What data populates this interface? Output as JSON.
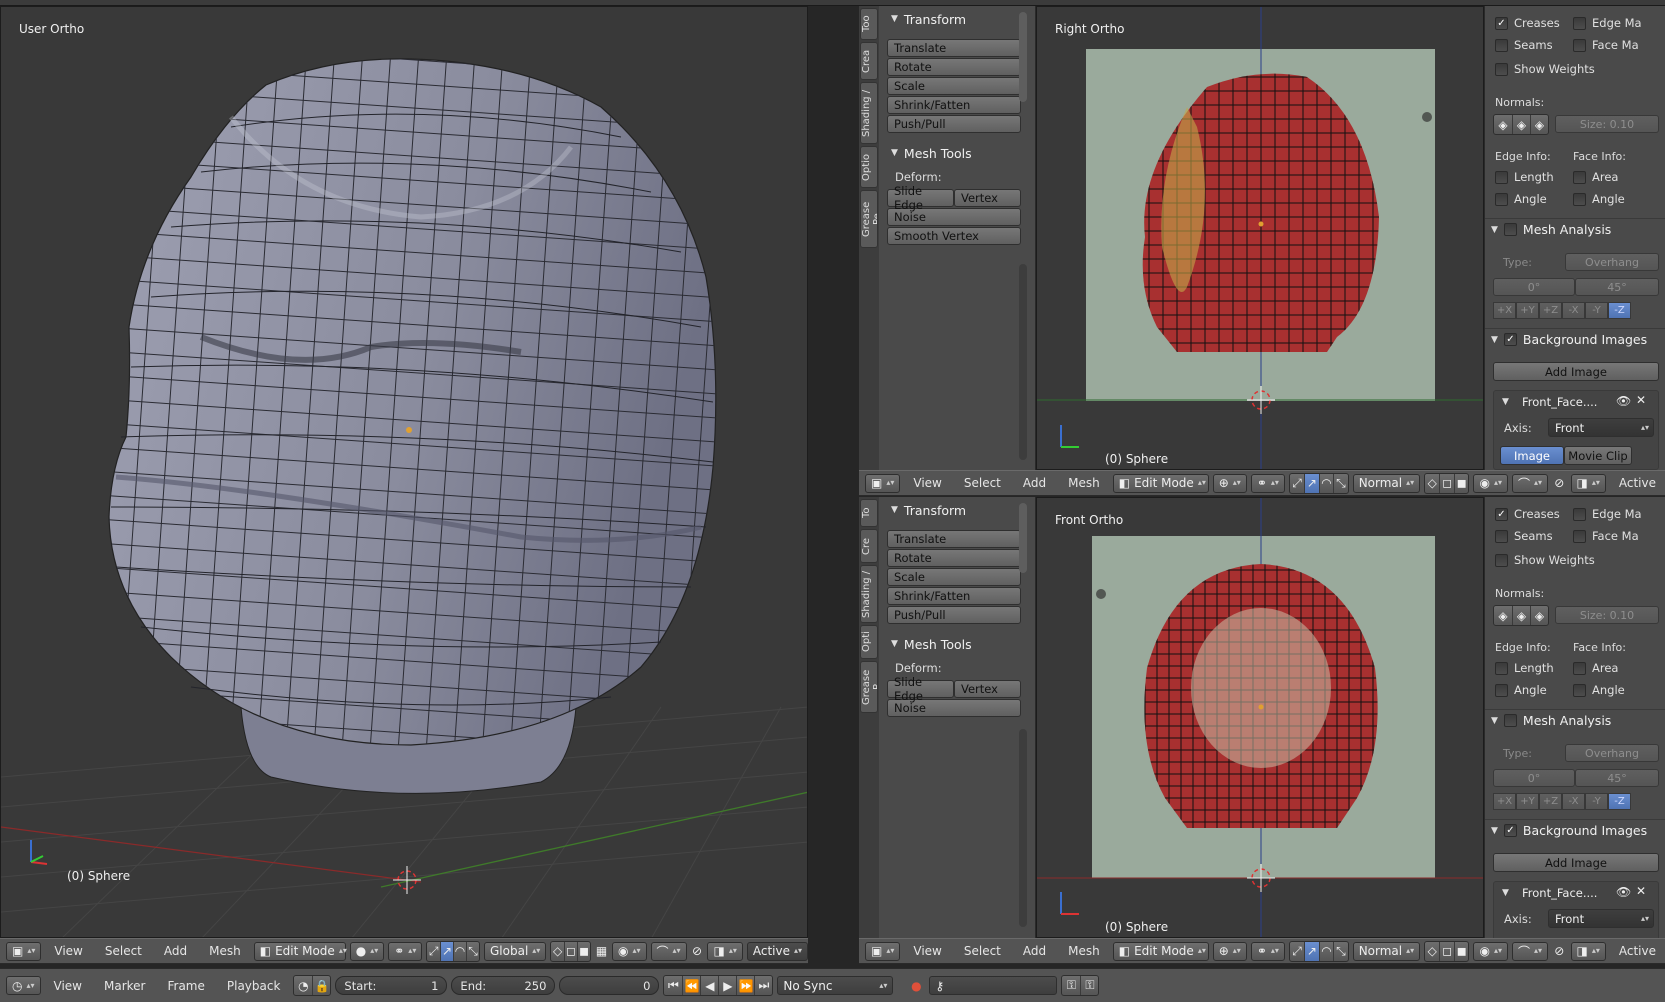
{
  "viewports": {
    "left": {
      "label": "User Ortho",
      "object": "(0) Sphere"
    },
    "top_right": {
      "label": "Right Ortho",
      "object": "(0) Sphere"
    },
    "bottom_right": {
      "label": "Front Ortho",
      "object": "(0) Sphere"
    }
  },
  "toolshelf": {
    "tabs_top": [
      "Too",
      "Crea",
      "Shading /",
      "Optio",
      "Grease Pe"
    ],
    "tabs_bottom": [
      "To",
      "Cre",
      "Shading /",
      "Opti",
      "Grease P"
    ],
    "transform_title": "Transform",
    "transform_buttons": [
      "Translate",
      "Rotate",
      "Scale",
      "Shrink/Fatten",
      "Push/Pull"
    ],
    "mesh_tools_title": "Mesh Tools",
    "deform_label": "Deform:",
    "slide_edge": "Slide Edge",
    "vertex": "Vertex",
    "noise": "Noise",
    "smooth_vertex": "Smooth Vertex"
  },
  "properties": {
    "creases": "Creases",
    "edge_marks": "Edge Ma",
    "seams": "Seams",
    "face_marks": "Face Ma",
    "show_weights": "Show Weights",
    "normals_label": "Normals:",
    "size_field": "Size:  0.10",
    "edge_info": "Edge Info:",
    "face_info": "Face Info:",
    "length": "Length",
    "area": "Area",
    "angle_e": "Angle",
    "angle_f": "Angle",
    "mesh_analysis": "Mesh Analysis",
    "type_label": "Type:",
    "type_value": "Overhang",
    "min_angle": "0°",
    "max_angle": "45°",
    "axes": [
      "+X",
      "+Y",
      "+Z",
      "-X",
      "-Y",
      "-Z"
    ],
    "background_images": "Background Images",
    "add_image": "Add Image",
    "bg_name": "Front_Face....",
    "axis_label": "Axis:",
    "axis_value": "Front",
    "image_tab": "Image",
    "movie_clip_tab": "Movie Clip"
  },
  "header": {
    "view": "View",
    "select": "Select",
    "add": "Add",
    "mesh": "Mesh",
    "mode": "Edit Mode",
    "pivot": "Global",
    "orientation": "Normal",
    "snap_target": "Active"
  },
  "timeline": {
    "view": "View",
    "marker": "Marker",
    "frame": "Frame",
    "playback": "Playback",
    "start_label": "Start:",
    "start_value": "1",
    "end_label": "End:",
    "end_value": "250",
    "current": "0",
    "sync": "No Sync"
  },
  "colors": {
    "viewport_bg": "#393939",
    "mesh_face": "#8d8fa0",
    "panel_bg": "#4a4a4a",
    "header_bg": "#545454",
    "accent_blue": "#5680c2"
  }
}
